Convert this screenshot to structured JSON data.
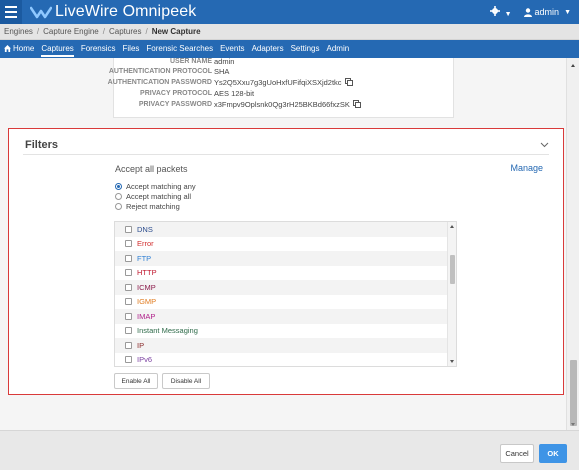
{
  "app": {
    "title": "LiveWire Omnipeek",
    "user": "admin",
    "colors": {
      "brand": "#2569b3",
      "accent": "#3e94e6",
      "highlight_border": "#d93a3a"
    }
  },
  "breadcrumb": {
    "items": [
      "Engines",
      "Capture Engine",
      "Captures"
    ],
    "current": "New Capture",
    "separator": "/"
  },
  "nav": {
    "home": "Home",
    "captures": "Captures",
    "forensics": "Forensics",
    "files": "Files",
    "forensic_searches": "Forensic Searches",
    "events": "Events",
    "adapters": "Adapters",
    "settings": "Settings",
    "admin": "Admin"
  },
  "auth": {
    "rows": [
      {
        "label": "USER NAME",
        "value": "admin"
      },
      {
        "label": "AUTHENTICATION PROTOCOL",
        "value": "SHA"
      },
      {
        "label": "AUTHENTICATION PASSWORD",
        "value": "Ys2Q5Xxu7g3gUoHxfUFifqiXSXjd2tkc"
      },
      {
        "label": "PRIVACY PROTOCOL",
        "value": "AES 128-bit"
      },
      {
        "label": "PRIVACY PASSWORD",
        "value": "x3Fmpv9Oplsnk0Qg3rH25BKBd66fxzSK"
      }
    ]
  },
  "filters": {
    "title": "Filters",
    "accept_all": "Accept all packets",
    "manage": "Manage",
    "radios": [
      {
        "label": "Accept matching any",
        "checked": true
      },
      {
        "label": "Accept matching all",
        "checked": false
      },
      {
        "label": "Reject matching",
        "checked": false
      }
    ],
    "list": [
      {
        "label": "DNS",
        "color": "#2a4a8c",
        "checked": false
      },
      {
        "label": "Error",
        "color": "#d23030",
        "checked": false
      },
      {
        "label": "FTP",
        "color": "#2f7fd4",
        "checked": false
      },
      {
        "label": "HTTP",
        "color": "#c0172e",
        "checked": false
      },
      {
        "label": "ICMP",
        "color": "#8b1a4a",
        "checked": false
      },
      {
        "label": "IGMP",
        "color": "#e07a1e",
        "checked": false
      },
      {
        "label": "IMAP",
        "color": "#b0208a",
        "checked": false
      },
      {
        "label": "Instant Messaging",
        "color": "#2f6b4a",
        "checked": false
      },
      {
        "label": "IP",
        "color": "#8a2a2a",
        "checked": false
      },
      {
        "label": "IPv6",
        "color": "#7a3fa0",
        "checked": false
      }
    ],
    "enable_all": "Enable All",
    "disable_all": "Disable All"
  },
  "footer": {
    "cancel": "Cancel",
    "ok": "OK"
  }
}
